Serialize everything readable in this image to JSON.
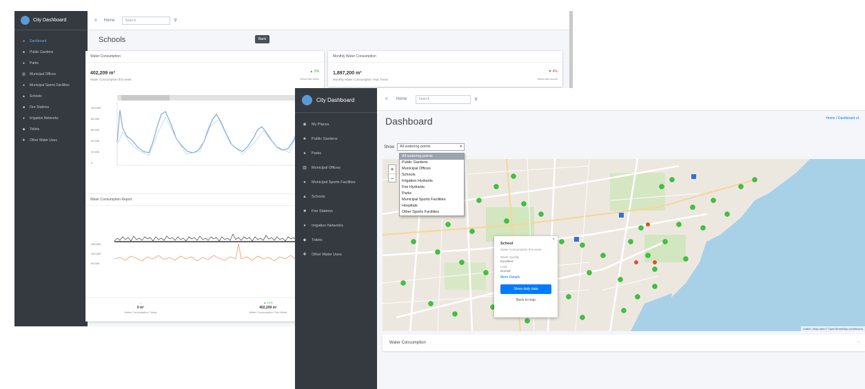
{
  "back_window": {
    "brand": "City Dashboard",
    "nav": [
      "Dashboard",
      "Public Gardens",
      "Parks",
      "Municipal Offices",
      "Municipal Sports Facilities",
      "Schools",
      "Fire Stations",
      "Irrigation Networks",
      "Toilets",
      "Other Water Uses"
    ],
    "topbar": {
      "home_label": "Home",
      "search_placeholder": "Search"
    },
    "page_title": "Schools",
    "title_button": "Back",
    "card_left": {
      "title": "Water Consumption",
      "value": "402,209 m³",
      "subtitle": "Water Consumption this week",
      "delta": "▲ 2%",
      "delta_note": "Since last week"
    },
    "card_right": {
      "title": "Monthly Water Consumption",
      "value": "1,897,200 m³",
      "subtitle": "Monthly Water Consumption Year Trend",
      "delta": "▼ 4%",
      "delta_note": "Since last month"
    },
    "chart1": {
      "y_ticks": [
        "100,000",
        "80,000",
        "60,000",
        "40,000",
        "20,000",
        "0"
      ],
      "legend": "Consumption"
    },
    "card_bottom": {
      "title": "Water Consumption Report"
    },
    "chart2": {
      "y_ticks": [
        "150,000",
        "100,000",
        "50,000"
      ]
    },
    "footer": [
      {
        "top": "—",
        "value": "0 m³",
        "label": "Water Consumption Today"
      },
      {
        "top": "▲ 10%",
        "value": "402,209 m³",
        "label": "Water Consumption This Week"
      }
    ]
  },
  "front_window": {
    "brand": "City Dashboard",
    "nav": [
      "My Places",
      "Public Gardens",
      "Parks",
      "Municipal Offices",
      "Municipal Sports Facilities",
      "Schools",
      "Fire Stations",
      "Irrigation Networks",
      "Toilets",
      "Other Water Uses"
    ],
    "topbar": {
      "home_label": "Home",
      "search_placeholder": "Search"
    },
    "page_title": "Dashboard",
    "breadcrumb": "Home / Dashboard v1",
    "filter": {
      "label": "Show",
      "selected": "All watering points",
      "options": [
        "All watering points",
        "Public Gardens",
        "Municipal Offices",
        "Schools",
        "Irrigation Hydrants",
        "Fire Hydrants",
        "Parks",
        "Municipal Sports Facilities",
        "Hospitals",
        "Other Sports Facilities"
      ]
    },
    "map": {
      "attribution": "Leaflet | Map data © OpenStreetMap contributors",
      "zoom_in": "+",
      "zoom_out": "−",
      "popup": {
        "title": "School",
        "line1": "Water Consumption this week",
        "line2": "Water Quality",
        "line2_value": "Excellent",
        "line3": "Leak",
        "line3_value": "Normal",
        "link": "More Details",
        "primary_button": "Show daily data",
        "secondary_button": "Back to map"
      }
    },
    "water_card": {
      "title": "Water Consumption",
      "tool": "−"
    }
  }
}
